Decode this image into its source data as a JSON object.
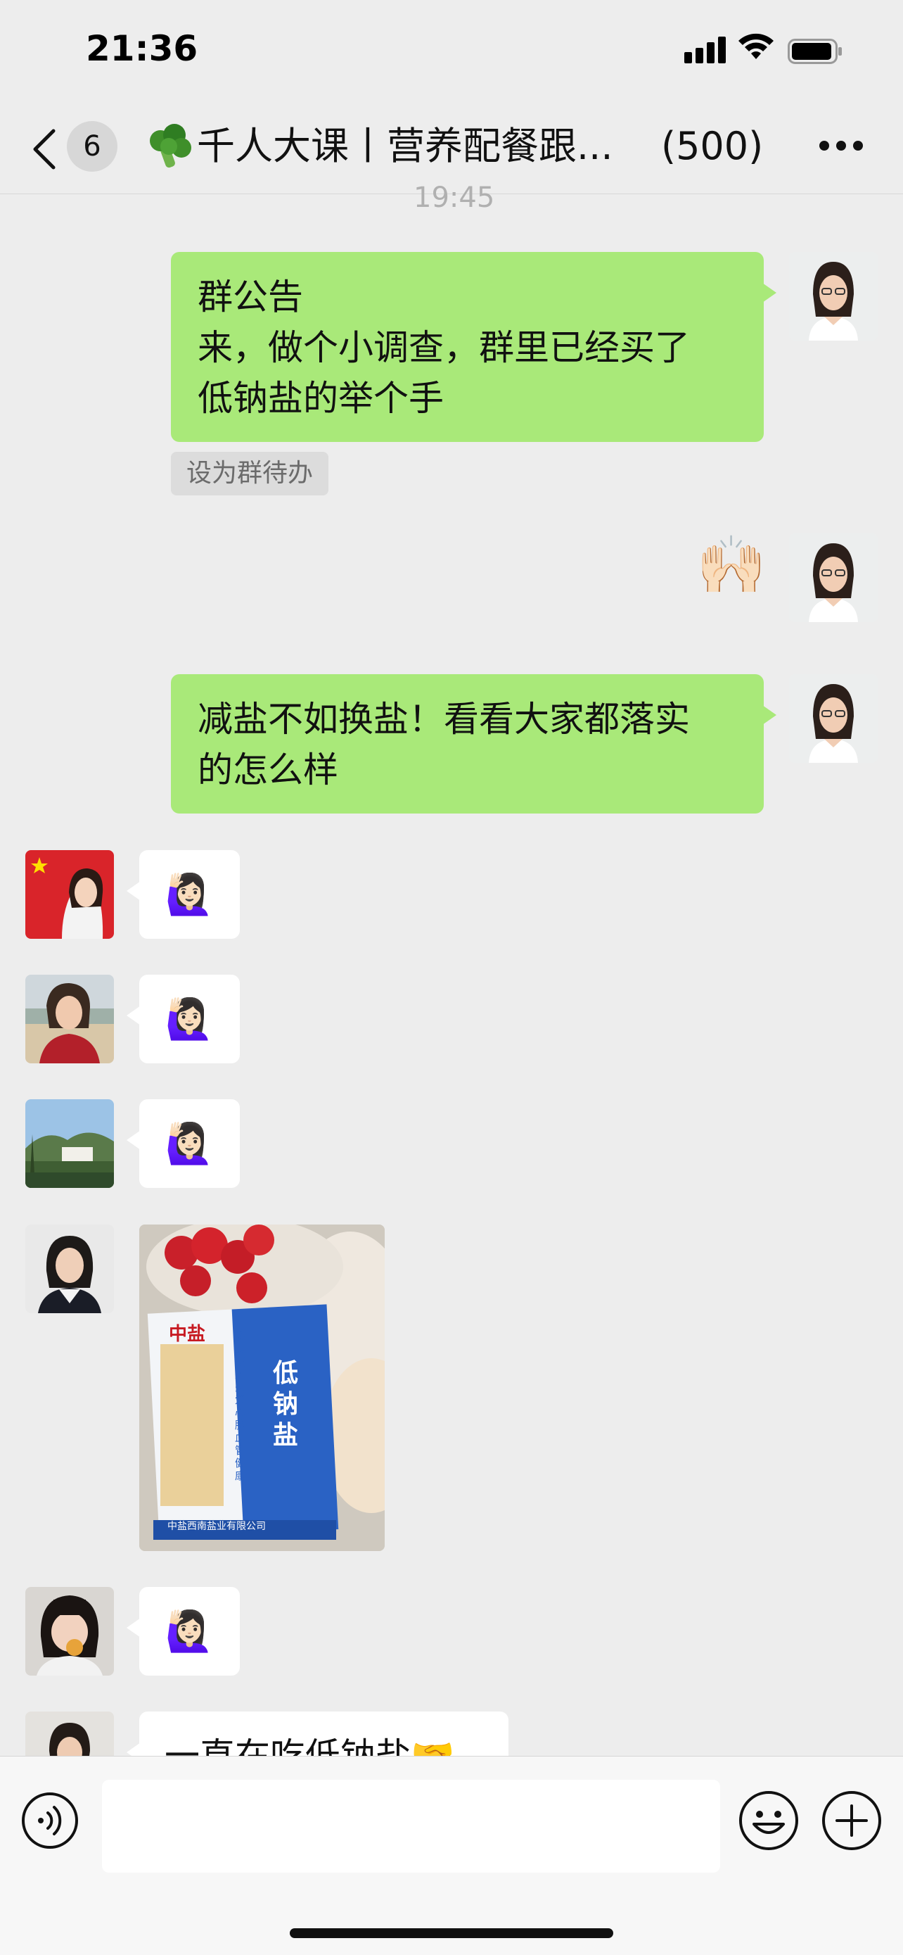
{
  "status_bar": {
    "time": "21:36"
  },
  "nav": {
    "back_badge": "6",
    "title": "千人大课丨营养配餐跟...",
    "member_count": "(500)"
  },
  "timestamp": "19:45",
  "messages": {
    "announcement": {
      "line1": "群公告",
      "line2": "来，做个小调查，群里已经买了",
      "line3": "低钠盐的举个手"
    },
    "todo_tag": "设为群待办",
    "clap_emoji": "🙌🏻",
    "slogan": {
      "line1": "减盐不如换盐！看看大家都落实",
      "line2": "的怎么样"
    },
    "raise_hand_emoji": "🙋🏻‍♀️",
    "photo": {
      "brand": "中盐",
      "product": "低钠盐",
      "vertical_text": "健康减盐关爱心脑血管健康",
      "maker": "中盐西南盐业有限公司"
    },
    "last_text": "一直在吃低钠盐🤝"
  },
  "colors": {
    "background": "#ededed",
    "green_bubble": "#a9e979",
    "white_bubble": "#ffffff"
  }
}
